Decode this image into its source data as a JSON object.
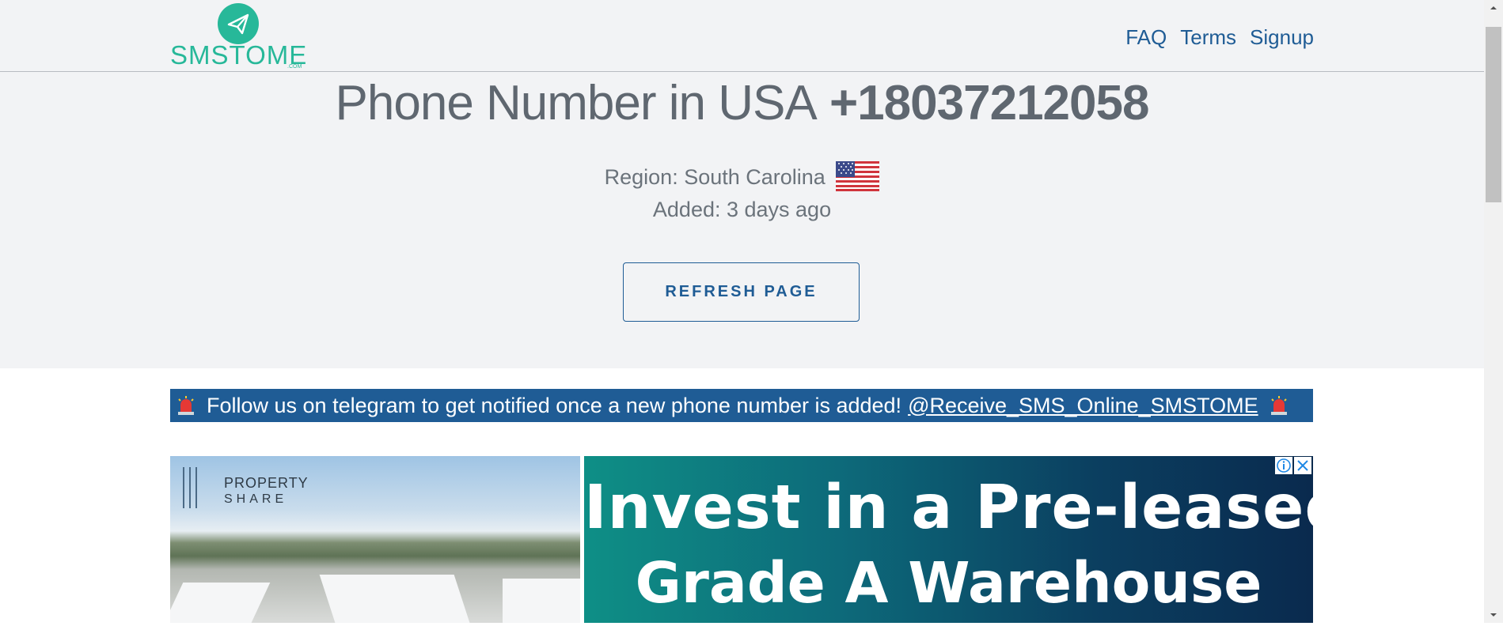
{
  "brand": {
    "name": "SMSTOME",
    "suffix": ".COM",
    "color": "#27b899"
  },
  "nav": {
    "links": [
      "FAQ",
      "Terms",
      "Signup"
    ]
  },
  "hero": {
    "title_prefix": "Phone Number in USA",
    "phone_number": "+18037212058",
    "region": "Region: South Carolina",
    "added": "Added: 3 days ago",
    "refresh_label": "REFRESH PAGE"
  },
  "telegram": {
    "text": "Follow us on telegram to get notified once a new phone number is added!",
    "link": "@Receive_SMS_Online_SMSTOME"
  },
  "ad": {
    "brand_line1": "PROPERTY",
    "brand_line2": "SHARE",
    "headline1": "Invest in a Pre-leased",
    "headline2": "Grade A Warehouse"
  },
  "colors": {
    "link": "#1f5c95",
    "hero_bg": "#f2f3f5",
    "banner_bg": "#1f5c95"
  }
}
